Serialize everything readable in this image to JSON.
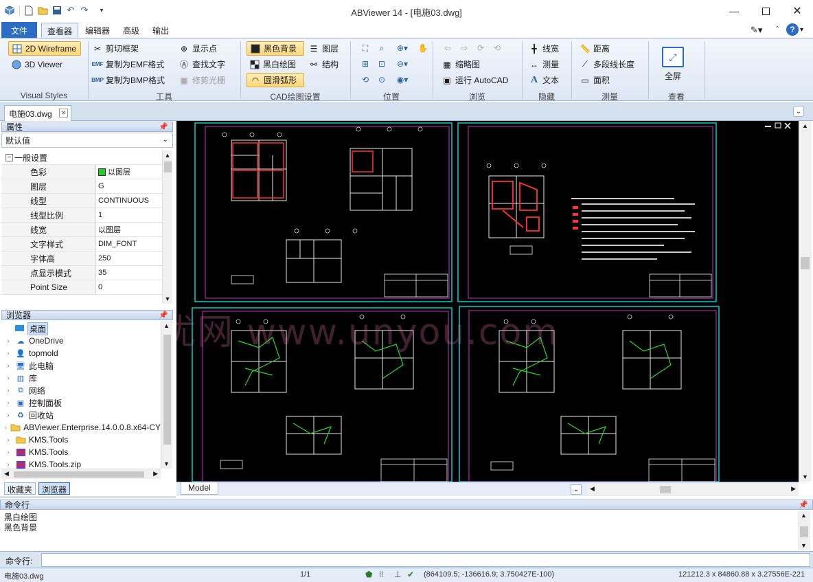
{
  "window": {
    "title": "ABViewer 14 - [电施03.dwg]"
  },
  "ribbon_tabs": [
    "文件",
    "查看器",
    "编辑器",
    "高级",
    "输出"
  ],
  "ribbon": {
    "visual_styles": {
      "label": "Visual Styles",
      "wireframe_2d": "2D Wireframe",
      "viewer_3d": "3D Viewer"
    },
    "tools": {
      "label": "工具",
      "clip_frame": "剪切框架",
      "copy_emf": "复制为EMF格式",
      "copy_bmp": "复制为BMP格式",
      "show_points": "显示点",
      "find_text": "查找文字",
      "clip_raster": "修剪光栅"
    },
    "cad_settings": {
      "label": "CAD绘图设置",
      "black_bg": "黑色背景",
      "bw_draw": "黑白绘图",
      "smooth_arc": "圆滑弧形",
      "layers": "图层",
      "structure": "结构"
    },
    "position": {
      "label": "位置"
    },
    "browse": {
      "label": "浏览",
      "thumbnail": "缩略图",
      "run_autocad": "运行 AutoCAD"
    },
    "hide": {
      "label": "隐藏",
      "line_width": "线宽",
      "measure": "测量",
      "text": "文本"
    },
    "measure": {
      "label": "测量",
      "distance": "距离",
      "polyline_length": "多段线长度",
      "area": "面积"
    },
    "view": {
      "label": "查看",
      "fullscreen": "全屏"
    }
  },
  "doc_tab": "电施03.dwg",
  "properties": {
    "title": "属性",
    "selector": "默认值",
    "section": "一般设置",
    "rows": [
      {
        "name": "色彩",
        "value": "以图层",
        "swatch": "#22cc22"
      },
      {
        "name": "图层",
        "value": "G"
      },
      {
        "name": "线型",
        "value": "CONTINUOUS"
      },
      {
        "name": "线型比例",
        "value": "1"
      },
      {
        "name": "线宽",
        "value": "以图层"
      },
      {
        "name": "文字样式",
        "value": "DIM_FONT"
      },
      {
        "name": "字体高",
        "value": "250"
      },
      {
        "name": "点显示模式",
        "value": "35"
      },
      {
        "name": "Point Size",
        "value": "0"
      }
    ]
  },
  "browser": {
    "title": "浏览器",
    "items": [
      {
        "label": "桌面",
        "icon": "desktop-icon"
      },
      {
        "label": "OneDrive",
        "icon": "cloud-icon"
      },
      {
        "label": "topmold",
        "icon": "user-icon"
      },
      {
        "label": "此电脑",
        "icon": "computer-icon"
      },
      {
        "label": "库",
        "icon": "library-icon"
      },
      {
        "label": "网络",
        "icon": "network-icon"
      },
      {
        "label": "控制面板",
        "icon": "control-panel-icon"
      },
      {
        "label": "回收站",
        "icon": "recycle-bin-icon"
      },
      {
        "label": "ABViewer.Enterprise.14.0.0.8.x64-CY",
        "icon": "folder-icon"
      },
      {
        "label": "KMS.Tools",
        "icon": "folder-icon"
      },
      {
        "label": "KMS.Tools",
        "icon": "archive-icon"
      },
      {
        "label": "KMS.Tools.zip",
        "icon": "zip-icon"
      }
    ],
    "tabs": [
      "收藏夹",
      "浏览器"
    ]
  },
  "watermark": "联合优网 www.unyou.com",
  "model_tab": "Model",
  "command": {
    "title": "命令行",
    "log": [
      "黑白绘图",
      "黑色背景"
    ],
    "prompt": "命令行:"
  },
  "status": {
    "file": "电施03.dwg",
    "page": "1/1",
    "coords": "(864109.5; -136616.9; 3.750427E-100)",
    "dims": "121212.3 x 84860.88 x 3.27556E-221"
  },
  "colors": {
    "accent": "#2b6cc4",
    "drawing_bg": "#000000",
    "frame": "#00d0d0",
    "sheet": "#cc33cc",
    "wiring": "#22dd22",
    "walls": "#ff3333"
  }
}
